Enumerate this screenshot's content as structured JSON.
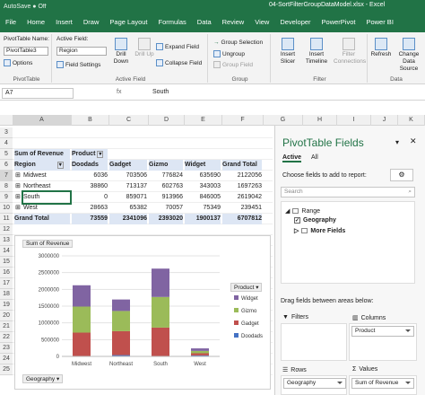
{
  "titlebar": {
    "autosave": "AutoSave  ● Off",
    "filename": "04-SortFilterGroupDataModel.xlsx  -  Excel"
  },
  "tabs": [
    "File",
    "Home",
    "Insert",
    "Draw",
    "Page Layout",
    "Formulas",
    "Data",
    "Review",
    "View",
    "Developer",
    "PowerPivot",
    "Power BI"
  ],
  "ribbon": {
    "pivottable": {
      "name_label": "PivotTable Name:",
      "name_value": "PivotTable3",
      "options_label": "Options",
      "group_label": "PivotTable"
    },
    "activefield": {
      "label": "Active Field:",
      "value": "Region",
      "settings_label": "Field Settings",
      "drill_down": "Drill Down",
      "drill_up": "Drill Up",
      "expand": "Expand Field",
      "collapse": "Collapse Field",
      "group_label": "Active Field"
    },
    "group": {
      "selection": "Group Selection",
      "ungroup": "Ungroup",
      "field": "Group Field",
      "group_label": "Group"
    },
    "filter": {
      "slicer": "Insert Slicer",
      "timeline": "Insert Timeline",
      "connections": "Filter Connections",
      "group_label": "Filter"
    },
    "data": {
      "refresh": "Refresh",
      "change": "Change Data Source",
      "group_label": "Data"
    }
  },
  "formulabar": {
    "namebox": "A7",
    "fx": "fx",
    "value": "South"
  },
  "columns": [
    "A",
    "B",
    "C",
    "D",
    "E",
    "F",
    "G",
    "H",
    "I",
    "J",
    "K"
  ],
  "rows": [
    "3",
    "4",
    "5",
    "6",
    "7",
    "8",
    "9",
    "10",
    "11",
    "12",
    "13",
    "14",
    "15",
    "16",
    "17",
    "18",
    "19",
    "20",
    "21",
    "22",
    "23",
    "24",
    "25"
  ],
  "pivot": {
    "title": "Sum of Revenue",
    "col_field": "Product",
    "row_field": "Region",
    "headers": [
      "Doodads",
      "Gadget",
      "Gizmo",
      "Widget",
      "Grand Total"
    ],
    "rows": [
      {
        "label": "Midwest",
        "values": [
          "6036",
          "703506",
          "776824",
          "635690",
          "2122056"
        ]
      },
      {
        "label": "Northeast",
        "values": [
          "38860",
          "713137",
          "602763",
          "343003",
          "1697263"
        ]
      },
      {
        "label": "South",
        "values": [
          "0",
          "859071",
          "913966",
          "846005",
          "2619042"
        ]
      },
      {
        "label": "West",
        "values": [
          "28663",
          "65382",
          "70057",
          "75349",
          "239451"
        ]
      }
    ],
    "grand": {
      "label": "Grand Total",
      "values": [
        "73559",
        "2341096",
        "2393020",
        "1900137",
        "6707812"
      ]
    }
  },
  "chart_data": {
    "type": "bar",
    "stacked": true,
    "title": "Sum of Revenue",
    "categories": [
      "Midwest",
      "Northeast",
      "South",
      "West"
    ],
    "series": [
      {
        "name": "Doodads",
        "values": [
          6036,
          38860,
          0,
          28663
        ],
        "color": "#4472c4"
      },
      {
        "name": "Gadget",
        "values": [
          703506,
          713137,
          859071,
          65382
        ],
        "color": "#c0504d"
      },
      {
        "name": "Gizmo",
        "values": [
          776824,
          602763,
          913966,
          70057
        ],
        "color": "#9bbb59"
      },
      {
        "name": "Widget",
        "values": [
          635690,
          343003,
          846005,
          75349
        ],
        "color": "#8064a2"
      }
    ],
    "yticks": [
      "3000000",
      "2500000",
      "2000000",
      "1500000",
      "1000000",
      "500000",
      "0"
    ],
    "ylim": [
      0,
      3000000
    ],
    "legend_title": "Product",
    "axis_button": "Geography",
    "legend_placement": "right"
  },
  "pane": {
    "title": "PivotTable Fields",
    "tabs": [
      "Active",
      "All"
    ],
    "instruction": "Choose fields to add to report:",
    "search_placeholder": "Search",
    "tree": [
      {
        "label": "Range",
        "expanded": true
      },
      {
        "label": "Geography",
        "checked": true
      },
      {
        "label": "More Fields",
        "expanded": false
      }
    ],
    "drag_label": "Drag fields between areas below:",
    "areas": {
      "filters": "Filters",
      "columns": "Columns",
      "rows": "Rows",
      "values": "Values",
      "columns_item": "Product",
      "rows_item": "Geography",
      "values_item": "Sum of Revenue"
    }
  }
}
